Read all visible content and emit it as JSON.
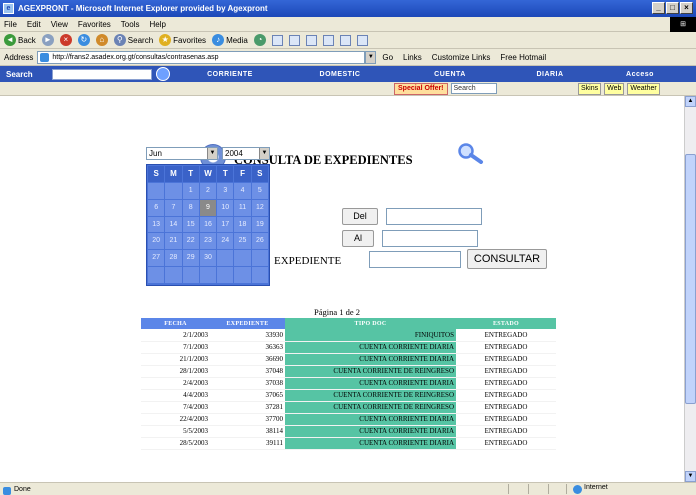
{
  "window": {
    "title": "AGEXPRONT - Microsoft Internet Explorer provided by Agexpront",
    "minimize": "_",
    "maximize": "□",
    "close": "×"
  },
  "menu": [
    "File",
    "Edit",
    "View",
    "Favorites",
    "Tools",
    "Help"
  ],
  "toolbar": {
    "back": "Back",
    "search": "Search",
    "favorites": "Favorites",
    "media": "Media"
  },
  "address": {
    "label": "Address",
    "url": "http://frans2.asadex.org.gt/consultas/contrasenas.asp",
    "go": "Go",
    "links": "Links",
    "customize": "Customize Links",
    "hotmail": "Free Hotmail"
  },
  "search_bar": {
    "label": "Search",
    "tabs": [
      "CORRIENTE",
      "DOMESTIC",
      "CUENTA",
      "DIARIA",
      "Acceso"
    ]
  },
  "links_bar": {
    "special_offer": "Special Offer!",
    "search_placeholder": "Search",
    "buttons": [
      "Skins",
      "Web",
      "Weather"
    ]
  },
  "page": {
    "title": "CONSULTA DE EXPEDIENTES",
    "calendar": {
      "month": "Jun",
      "year": "2004",
      "weekdays": [
        "S",
        "M",
        "T",
        "W",
        "T",
        "F",
        "S"
      ],
      "days": [
        "",
        "",
        "1",
        "2",
        "3",
        "4",
        "5",
        "6",
        "7",
        "8",
        "9",
        "10",
        "11",
        "12",
        "13",
        "14",
        "15",
        "16",
        "17",
        "18",
        "19",
        "20",
        "21",
        "22",
        "23",
        "24",
        "25",
        "26",
        "27",
        "28",
        "29",
        "30",
        "",
        "",
        "",
        "",
        "",
        "",
        "",
        "",
        "",
        "",
        "",
        ""
      ],
      "selected_day": "9"
    },
    "form": {
      "del_label": "Del",
      "al_label": "Al",
      "del_value": "",
      "al_value": "",
      "expediente_label": "EXPEDIENTE",
      "expediente_value": "",
      "consultar": "CONSULTAR"
    },
    "pagination": "Página 1 de 2",
    "table": {
      "headers": [
        "FECHA",
        "EXPEDIENTE",
        "TIPO DOC",
        "ESTADO"
      ],
      "rows": [
        {
          "date": "2/1/2003",
          "num": "33930",
          "type": "FINIQUITOS",
          "status": "ENTREGADO"
        },
        {
          "date": "7/1/2003",
          "num": "36363",
          "type": "CUENTA CORRIENTE DIARIA",
          "status": "ENTREGADO"
        },
        {
          "date": "21/1/2003",
          "num": "36690",
          "type": "CUENTA CORRIENTE DIARIA",
          "status": "ENTREGADO"
        },
        {
          "date": "28/1/2003",
          "num": "37048",
          "type": "CUENTA CORRIENTE DE REINGRESO",
          "status": "ENTREGADO"
        },
        {
          "date": "2/4/2003",
          "num": "37038",
          "type": "CUENTA CORRIENTE DIARIA",
          "status": "ENTREGADO"
        },
        {
          "date": "4/4/2003",
          "num": "37065",
          "type": "CUENTA CORRIENTE DE REINGRESO",
          "status": "ENTREGADO"
        },
        {
          "date": "7/4/2003",
          "num": "37281",
          "type": "CUENTA CORRIENTE DE REINGRESO",
          "status": "ENTREGADO"
        },
        {
          "date": "22/4/2003",
          "num": "37700",
          "type": "CUENTA CORRIENTE DIARIA",
          "status": "ENTREGADO"
        },
        {
          "date": "5/5/2003",
          "num": "38114",
          "type": "CUENTA CORRIENTE DIARIA",
          "status": "ENTREGADO"
        },
        {
          "date": "28/5/2003",
          "num": "39111",
          "type": "CUENTA CORRIENTE DIARIA",
          "status": "ENTREGADO"
        }
      ]
    }
  },
  "status": {
    "text": "Done",
    "zone": "Internet"
  },
  "colors": {
    "header_blue": "#5b86e8",
    "header_green": "#56c4a4",
    "calendar_blue": "#4b74d8"
  },
  "icons": [
    "back-icon",
    "forward-icon",
    "stop-icon",
    "refresh-icon",
    "home-icon",
    "search-icon",
    "favorites-icon",
    "media-icon",
    "history-icon",
    "mail-icon",
    "print-icon",
    "magnifier-icon"
  ]
}
